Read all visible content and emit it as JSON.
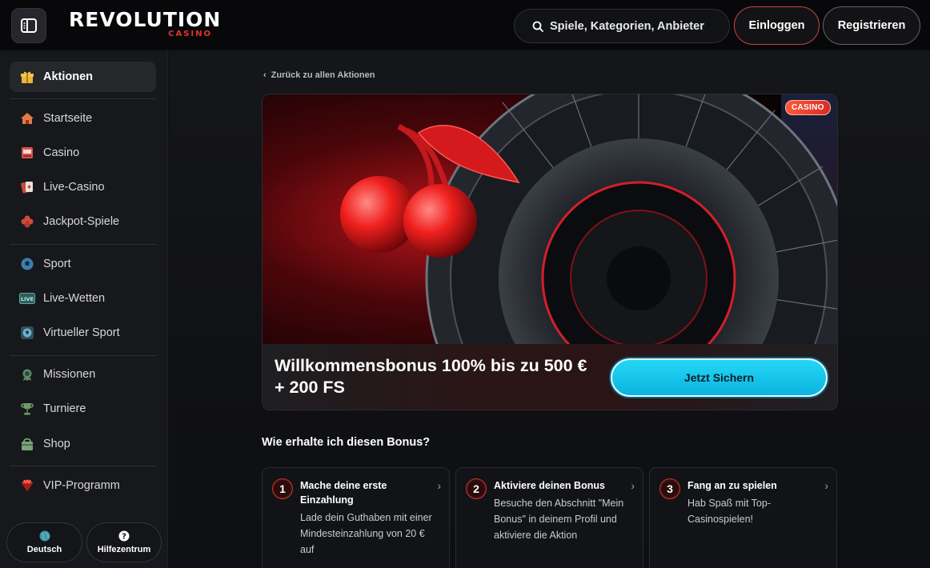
{
  "header": {
    "logo_main": "REVOLUTION",
    "logo_sub": "CASINO",
    "search_placeholder": "Spiele, Kategorien, Anbieter",
    "login_label": "Einloggen",
    "register_label": "Registrieren"
  },
  "sidebar": {
    "items": [
      {
        "label": "Aktionen",
        "icon": "gift-icon"
      },
      {
        "label": "Startseite",
        "icon": "home-icon"
      },
      {
        "label": "Casino",
        "icon": "slot-machine-icon"
      },
      {
        "label": "Live-Casino",
        "icon": "cards-icon"
      },
      {
        "label": "Jackpot-Spiele",
        "icon": "clover-icon"
      },
      {
        "label": "Sport",
        "icon": "ball-icon"
      },
      {
        "label": "Live-Wetten",
        "icon": "live-icon"
      },
      {
        "label": "Virtueller Sport",
        "icon": "virtual-ball-icon"
      },
      {
        "label": "Missionen",
        "icon": "medal-icon"
      },
      {
        "label": "Turniere",
        "icon": "trophy-icon"
      },
      {
        "label": "Shop",
        "icon": "shop-icon"
      },
      {
        "label": "VIP-Programm",
        "icon": "diamond-icon"
      }
    ],
    "language_label": "Deutsch",
    "help_label": "Hilfezentrum"
  },
  "main": {
    "back_link": "Zurück zu allen Aktionen",
    "promo": {
      "badge": "CASINO",
      "title": "Willkommensbonus 100% bis zu 500 € + 200 FS",
      "cta_label": "Jetzt Sichern"
    },
    "how_title": "Wie erhalte ich diesen Bonus?",
    "steps": [
      {
        "number": "1",
        "title": "Mache deine erste Einzahlung",
        "desc": "Lade dein Guthaben mit einer Mindesteinzahlung von 20 € auf"
      },
      {
        "number": "2",
        "title": "Aktiviere deinen Bonus",
        "desc": "Besuche den Abschnitt \"Mein Bonus\" in deinem Profil und aktiviere die Aktion"
      },
      {
        "number": "3",
        "title": "Fang an zu spielen",
        "desc": "Hab Spaß mit Top-Casinospielen!"
      }
    ]
  },
  "colors": {
    "accent_red": "#e8322b",
    "cta_cyan": "#1cc8ee",
    "background": "#0f1013"
  }
}
